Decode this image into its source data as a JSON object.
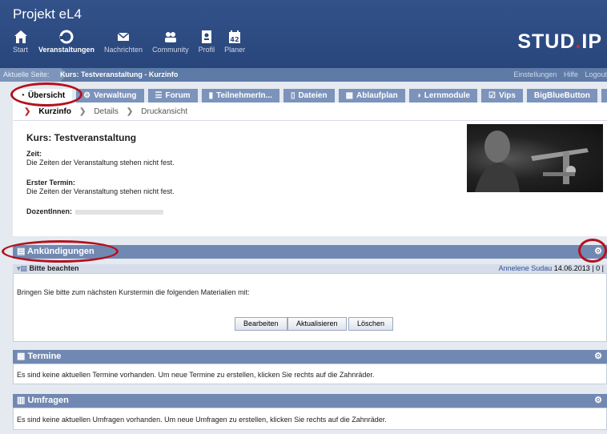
{
  "header": {
    "project": "Projekt eL4",
    "logo_prefix": "STUD",
    "logo_dot": ".",
    "logo_suffix": "IP",
    "nav": [
      {
        "label": "Start",
        "icon": "home-icon"
      },
      {
        "label": "Veranstaltungen",
        "icon": "courses-icon"
      },
      {
        "label": "Nachrichten",
        "icon": "mail-icon"
      },
      {
        "label": "Community",
        "icon": "community-icon"
      },
      {
        "label": "Profil",
        "icon": "profile-icon"
      },
      {
        "label": "Planer",
        "icon": "calendar-icon"
      }
    ]
  },
  "breadcrumb": {
    "label": "Aktuelle Seite:",
    "path": "Kurs: Testveranstaltung - Kurzinfo",
    "links": [
      "Einstellungen",
      "Hilfe",
      "Logout"
    ]
  },
  "tabs": [
    {
      "label": "Übersicht",
      "icon": "overview-icon"
    },
    {
      "label": "Verwaltung",
      "icon": "admin-icon"
    },
    {
      "label": "Forum",
      "icon": "forum-icon"
    },
    {
      "label": "TeilnehmerIn...",
      "icon": "participants-icon"
    },
    {
      "label": "Dateien",
      "icon": "files-icon"
    },
    {
      "label": "Ablaufplan",
      "icon": "schedule-icon"
    },
    {
      "label": "Lernmodule",
      "icon": "learning-icon"
    },
    {
      "label": "Vips",
      "icon": "vips-icon"
    },
    {
      "label": "BigBlueButton",
      "icon": ""
    },
    {
      "label": "+",
      "icon": ""
    }
  ],
  "subnav": [
    "Kurzinfo",
    "Details",
    "Druckansicht"
  ],
  "course": {
    "title": "Kurs: Testveranstaltung",
    "zeit_label": "Zeit:",
    "zeit_value": "Die Zeiten der Veranstaltung stehen nicht fest.",
    "termin_label": "Erster Termin:",
    "termin_value": "Die Zeiten der Veranstaltung stehen nicht fest.",
    "dozent_label": "DozentInnen:"
  },
  "announcements": {
    "title": "Ankündigungen",
    "item_title": "Bitte beachten",
    "author": "Annelene Sudau",
    "date": "14.06.2013",
    "meta": "| 0 |",
    "body": "Bringen Sie bitte zum nächsten Kurstermin die folgenden Materialien mit:",
    "buttons": [
      "Bearbeiten",
      "Aktualisieren",
      "Löschen"
    ]
  },
  "termine": {
    "title": "Termine",
    "text": "Es sind keine aktuellen Termine vorhanden. Um neue Termine zu erstellen, klicken Sie rechts auf die Zahnräder."
  },
  "umfragen": {
    "title": "Umfragen",
    "text": "Es sind keine aktuellen Umfragen vorhanden. Um neue Umfragen zu erstellen, klicken Sie rechts auf die Zahnräder."
  },
  "colors": {
    "header": "#28467b",
    "tab": "#7c93bb",
    "panel_header": "#7189b2",
    "highlight": "#b3121d",
    "logo_accent": "#d7262b"
  }
}
